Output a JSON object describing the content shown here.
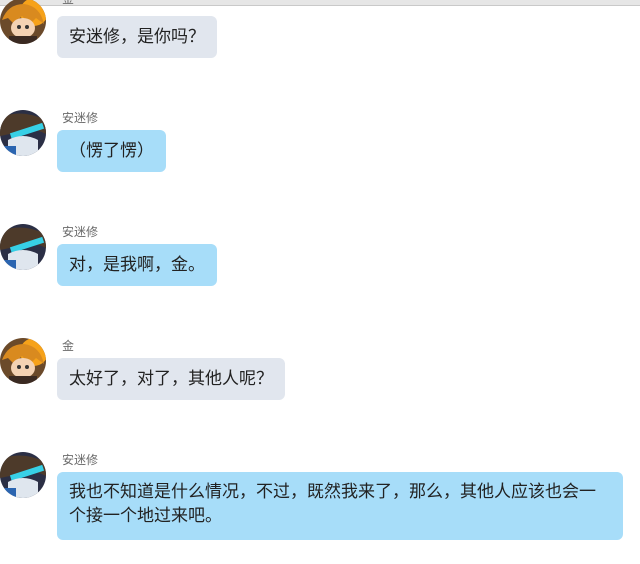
{
  "colors": {
    "kim_bubble": "#e1e6ee",
    "anmisu_bubble": "#a7ddf9"
  },
  "messages": [
    {
      "sender": "金",
      "avatar": "kim-avatar",
      "text": "安迷修，是你吗？"
    },
    {
      "sender": "安迷修",
      "avatar": "anmisu-avatar",
      "text": "（愣了愣）"
    },
    {
      "sender": "安迷修",
      "avatar": "anmisu-avatar",
      "text": "对，是我啊，金。"
    },
    {
      "sender": "金",
      "avatar": "kim-avatar",
      "text": "太好了，对了，其他人呢？"
    },
    {
      "sender": "安迷修",
      "avatar": "anmisu-avatar",
      "text": "我也不知道是什么情况，不过，既然我来了，那么，其他人应该也会一个接一个地过来吧。"
    }
  ]
}
